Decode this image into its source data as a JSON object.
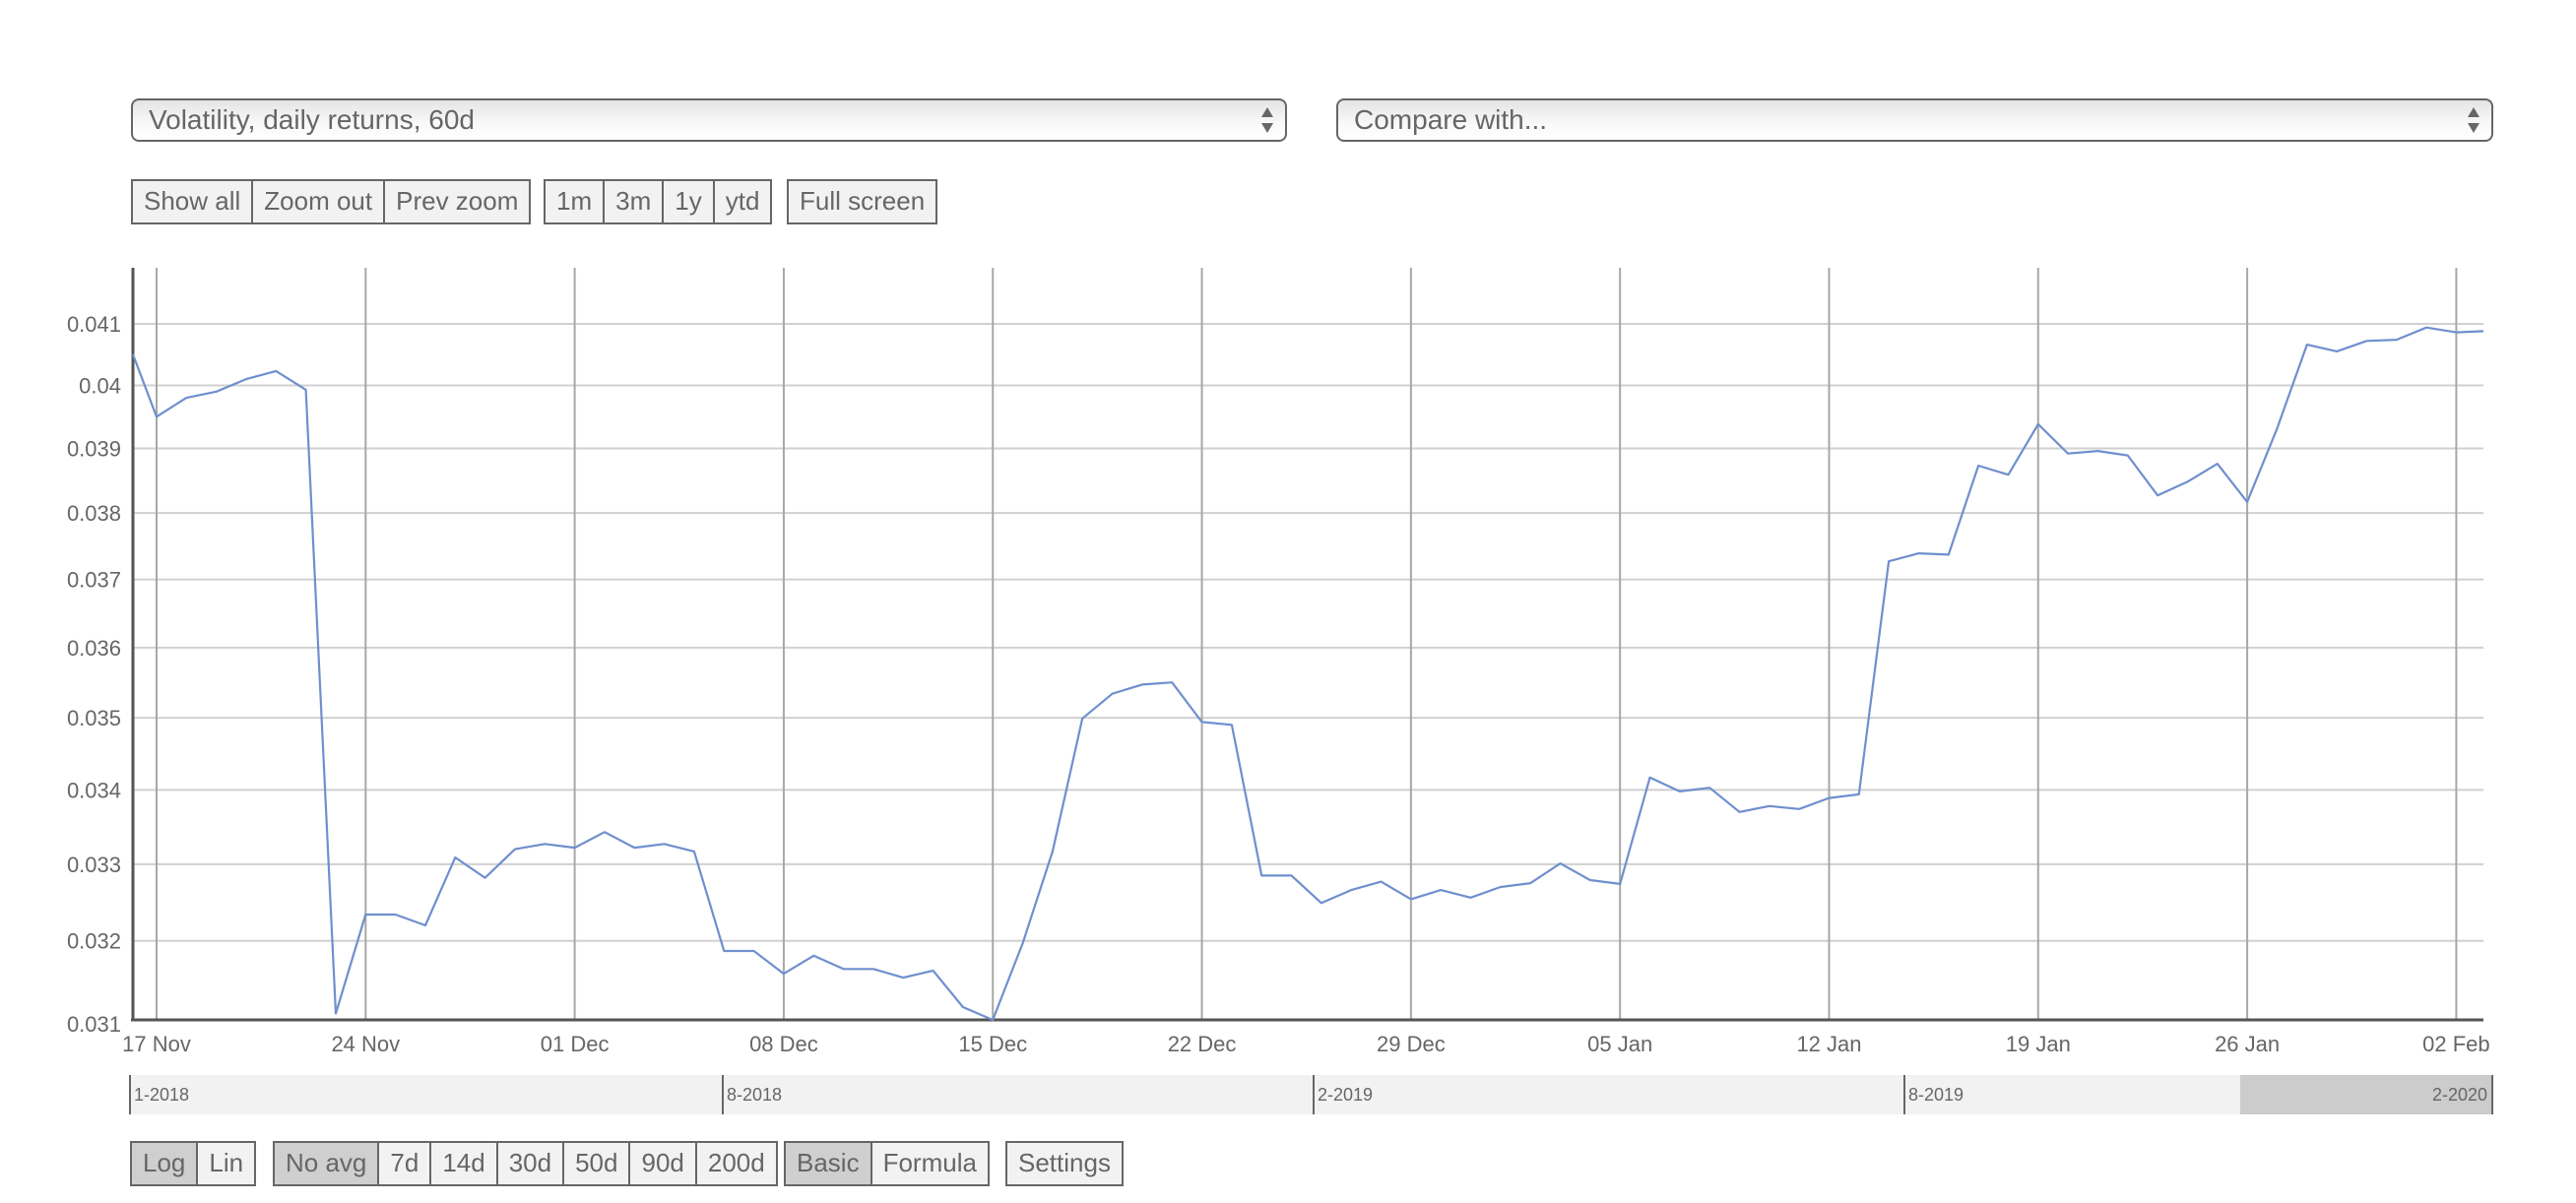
{
  "selectors": {
    "metric": {
      "value": "Volatility, daily returns, 60d"
    },
    "compare": {
      "placeholder": "Compare with..."
    }
  },
  "zoom_buttons": [
    {
      "label": "Show all"
    },
    {
      "label": "Zoom out"
    },
    {
      "label": "Prev zoom"
    }
  ],
  "range_buttons": [
    {
      "label": "1m"
    },
    {
      "label": "3m"
    },
    {
      "label": "1y"
    },
    {
      "label": "ytd"
    }
  ],
  "fullscreen_button": {
    "label": "Full screen"
  },
  "scale_buttons": [
    {
      "label": "Log",
      "active": true
    },
    {
      "label": "Lin",
      "active": false
    }
  ],
  "avg_buttons": [
    {
      "label": "No avg",
      "active": true
    },
    {
      "label": "7d",
      "active": false
    },
    {
      "label": "14d",
      "active": false
    },
    {
      "label": "30d",
      "active": false
    },
    {
      "label": "50d",
      "active": false
    },
    {
      "label": "90d",
      "active": false
    },
    {
      "label": "200d",
      "active": false
    }
  ],
  "mode_buttons": [
    {
      "label": "Basic",
      "active": true
    },
    {
      "label": "Formula",
      "active": false
    }
  ],
  "settings_button": {
    "label": "Settings"
  },
  "navigator": {
    "markers": [
      "1-2018",
      "8-2018",
      "2-2019",
      "8-2019",
      "2-2020"
    ],
    "selection_label": "2-2020"
  },
  "colors": {
    "line": "#6f8fce",
    "grid": "#d0d0d0",
    "vgrid": "#a8a8a8",
    "axis": "#555555",
    "text": "#666666"
  },
  "chart_data": {
    "type": "line",
    "title": "",
    "xlabel": "",
    "ylabel": "",
    "yscale": "log",
    "ylim": [
      0.031,
      0.0418
    ],
    "grid": true,
    "legend": "none",
    "start_date": "16 Nov",
    "x_tick_labels": [
      "17 Nov",
      "24 Nov",
      "01 Dec",
      "08 Dec",
      "15 Dec",
      "22 Dec",
      "29 Dec",
      "05 Jan",
      "12 Jan",
      "19 Jan",
      "26 Jan",
      "02 Feb"
    ],
    "y_ticks": [
      0.031,
      0.032,
      0.033,
      0.034,
      0.035,
      0.036,
      0.037,
      0.038,
      0.039,
      0.04,
      0.041
    ],
    "y_tick_labels": [
      "0.031",
      "0.032",
      "0.033",
      "0.034",
      "0.035",
      "0.036",
      "0.037",
      "0.038",
      "0.039",
      "0.04",
      "0.041"
    ],
    "series": [
      {
        "name": "Volatility, daily returns, 60d",
        "x": [
          "16 Nov",
          "17 Nov",
          "18 Nov",
          "19 Nov",
          "20 Nov",
          "21 Nov",
          "22 Nov",
          "23 Nov",
          "24 Nov",
          "25 Nov",
          "26 Nov",
          "27 Nov",
          "28 Nov",
          "29 Nov",
          "30 Nov",
          "01 Dec",
          "02 Dec",
          "03 Dec",
          "04 Dec",
          "05 Dec",
          "06 Dec",
          "07 Dec",
          "08 Dec",
          "09 Dec",
          "10 Dec",
          "11 Dec",
          "12 Dec",
          "13 Dec",
          "14 Dec",
          "15 Dec",
          "16 Dec",
          "17 Dec",
          "18 Dec",
          "19 Dec",
          "20 Dec",
          "21 Dec",
          "22 Dec",
          "23 Dec",
          "24 Dec",
          "25 Dec",
          "26 Dec",
          "27 Dec",
          "28 Dec",
          "29 Dec",
          "30 Dec",
          "31 Dec",
          "01 Jan",
          "02 Jan",
          "03 Jan",
          "04 Jan",
          "05 Jan",
          "06 Jan",
          "07 Jan",
          "08 Jan",
          "09 Jan",
          "10 Jan",
          "11 Jan",
          "12 Jan",
          "13 Jan",
          "14 Jan",
          "15 Jan",
          "16 Jan",
          "17 Jan",
          "18 Jan",
          "19 Jan",
          "20 Jan",
          "21 Jan",
          "22 Jan",
          "23 Jan",
          "24 Jan",
          "25 Jan",
          "26 Jan",
          "27 Jan",
          "28 Jan",
          "29 Jan",
          "30 Jan",
          "31 Jan",
          "01 Feb",
          "02 Feb",
          "03 Feb"
        ],
        "values": [
          0.0405,
          0.0395,
          0.0398,
          0.0399,
          0.0401,
          0.04023,
          0.03993,
          0.03108,
          0.03234,
          0.03234,
          0.0322,
          0.03309,
          0.03282,
          0.0332,
          0.03327,
          0.03322,
          0.03343,
          0.03322,
          0.03327,
          0.03317,
          0.03187,
          0.03187,
          0.03158,
          0.03181,
          0.03164,
          0.03164,
          0.03153,
          0.03162,
          0.03116,
          0.031,
          0.03197,
          0.03317,
          0.03499,
          0.03534,
          0.03547,
          0.0355,
          0.03494,
          0.0349,
          0.03285,
          0.03285,
          0.03249,
          0.03266,
          0.03277,
          0.03254,
          0.03266,
          0.03256,
          0.0327,
          0.03275,
          0.03301,
          0.03279,
          0.03274,
          0.03417,
          0.03398,
          0.03403,
          0.0337,
          0.03378,
          0.03374,
          0.03389,
          0.03394,
          0.03727,
          0.03739,
          0.03737,
          0.03873,
          0.03859,
          0.03938,
          0.03892,
          0.03896,
          0.03889,
          0.03827,
          0.03848,
          0.03876,
          0.03817,
          0.03931,
          0.04066,
          0.04055,
          0.04072,
          0.04074,
          0.04094,
          0.04086,
          0.04088
        ]
      }
    ]
  }
}
